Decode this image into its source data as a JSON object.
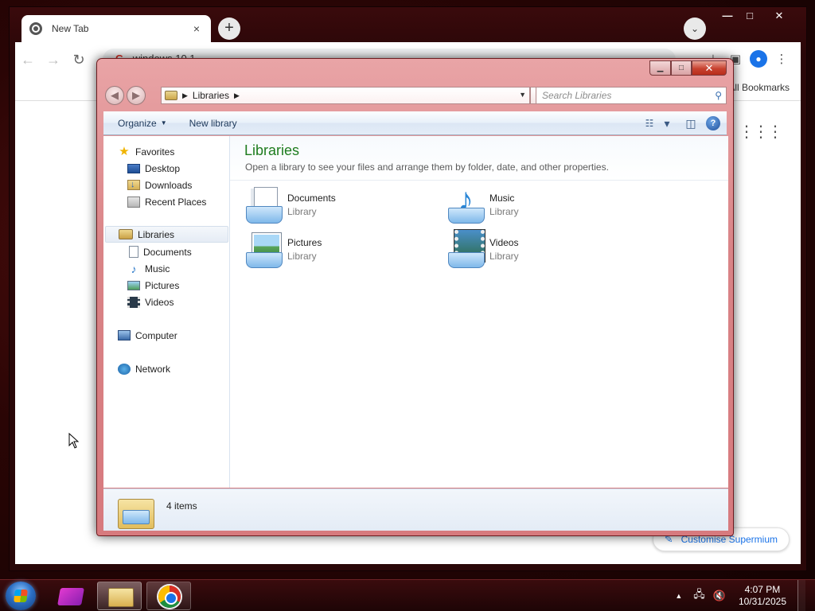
{
  "browser": {
    "tab_title": "New Tab",
    "tab_close": "×",
    "new_tab": "+",
    "tab_search": "⌄",
    "window_controls": {
      "minimize": "—",
      "maximize": "□",
      "close": "✕"
    },
    "nav": {
      "back": "←",
      "forward": "→",
      "reload": "↻"
    },
    "omnibox_text": "windows 10 1",
    "all_bookmarks": "All Bookmarks",
    "apps_icon": "⋮⋮⋮",
    "customise_label": "Customise Supermium",
    "customise_icon": "✎"
  },
  "explorer": {
    "caption": {
      "minimize": "▁",
      "maximize": "□",
      "close": "✕"
    },
    "nav_back": "◀",
    "nav_forward": "▶",
    "breadcrumb": [
      "Libraries"
    ],
    "breadcrumb_sep": "▶",
    "address_dropdown": "▼",
    "refresh_icon": "⇄",
    "search_placeholder": "Search Libraries",
    "search_icon": "⚲",
    "commands": {
      "organize": "Organize",
      "organize_arrow": "▼",
      "new_library": "New library",
      "views_icon": "☷",
      "views_arrow": "▾",
      "preview_pane_icon": "◫",
      "help_icon": "?"
    },
    "nav_pane": {
      "favorites": "Favorites",
      "favorites_items": [
        "Desktop",
        "Downloads",
        "Recent Places"
      ],
      "libraries": "Libraries",
      "libraries_items": [
        "Documents",
        "Music",
        "Pictures",
        "Videos"
      ],
      "computer": "Computer",
      "network": "Network"
    },
    "main": {
      "title": "Libraries",
      "subtitle": "Open a library to see your files and arrange them by folder, date, and other properties.",
      "libraries": [
        {
          "name": "Documents",
          "type": "Library"
        },
        {
          "name": "Music",
          "type": "Library"
        },
        {
          "name": "Pictures",
          "type": "Library"
        },
        {
          "name": "Videos",
          "type": "Library"
        }
      ]
    },
    "details_text": "4 items"
  },
  "taskbar": {
    "tray_arrow": "▲",
    "time": "4:07 PM",
    "date": "10/31/2025"
  },
  "colors": {
    "explorer_frame": "#d98487",
    "library_title_green": "#1e7c1e",
    "link_blue": "#1a73e8",
    "taskbar": "#2a0708"
  }
}
